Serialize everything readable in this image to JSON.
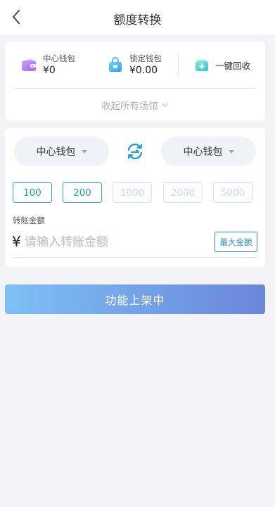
{
  "header": {
    "title": "额度转换"
  },
  "wallets": {
    "center": {
      "name": "中心钱包",
      "amount": "¥0",
      "icon": "purple-wallet-icon"
    },
    "locked": {
      "name": "锁定钱包",
      "amount": "¥0.00",
      "icon": "blue-lock-bag-icon"
    },
    "recycle": {
      "label": "一键回收",
      "icon": "green-download-icon"
    },
    "collapse_label": "收起所有场馆"
  },
  "transfer": {
    "from_wallet": "中心钱包",
    "to_wallet": "中心钱包",
    "quick_amounts": [
      {
        "label": "100",
        "enabled": true
      },
      {
        "label": "200",
        "enabled": true
      },
      {
        "label": "1000",
        "enabled": false
      },
      {
        "label": "2000",
        "enabled": false
      },
      {
        "label": "5000",
        "enabled": false
      }
    ],
    "amount_label": "转账金额",
    "currency_symbol": "¥",
    "amount_placeholder": "请输入转账金额",
    "amount_value": "",
    "max_label": "最大金额"
  },
  "submit_label": "功能上架中",
  "colors": {
    "accent": "#2196e0",
    "button_gradient_start": "#7ec0f5",
    "button_gradient_end": "#6a86da",
    "background": "#f3f3f5"
  }
}
